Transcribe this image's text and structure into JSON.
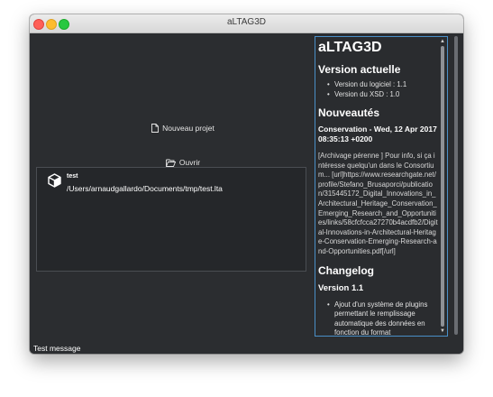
{
  "window": {
    "title": "aLTAG3D"
  },
  "actions": {
    "new_project_label": "Nouveau projet",
    "open_label": "Ouvrir"
  },
  "recent_projects": [
    {
      "name": "test",
      "path": "/Users/arnaudgallardo/Documents/tmp/test.lta"
    }
  ],
  "info_panel": {
    "app_title": "aLTAG3D",
    "version_heading": "Version actuelle",
    "version_items": [
      "Version du logiciel : 1.1",
      "Version du XSD : 1.0"
    ],
    "news_heading": "Nouveautés",
    "news_title": "Conservation - Wed, 12 Apr 2017 08:35:13 +0200",
    "news_body": "[Archivage pérenne ] Pour info, si ça intéresse quelqu'un dans le Consortium... [url]https://www.researchgate.net/profile/Stefano_Brusaporci/publication/315445172_Digital_Innovations_in_Architectural_Heritage_Conservation_Emerging_Research_and_Opportunities/links/58cfcfcca27270b4acdfb2/Digital-Innovations-in-Architectural-Heritage-Conservation-Emerging-Research-and-Opportunities.pdf[/url]",
    "changelog_heading": "Changelog",
    "changelog_version": "Version 1.1",
    "changelog_items": [
      "Ajout d'un système de plugins permettant le remplissage automatique des données en fonction du format"
    ]
  },
  "status_bar": {
    "message": "Test message"
  },
  "colors": {
    "background": "#2b2d30",
    "panel_border": "#4a8fc7",
    "text": "#ffffff"
  },
  "icons": {
    "new_project": "document-icon",
    "open": "folder-open-icon",
    "recent_project": "cube-icon"
  }
}
